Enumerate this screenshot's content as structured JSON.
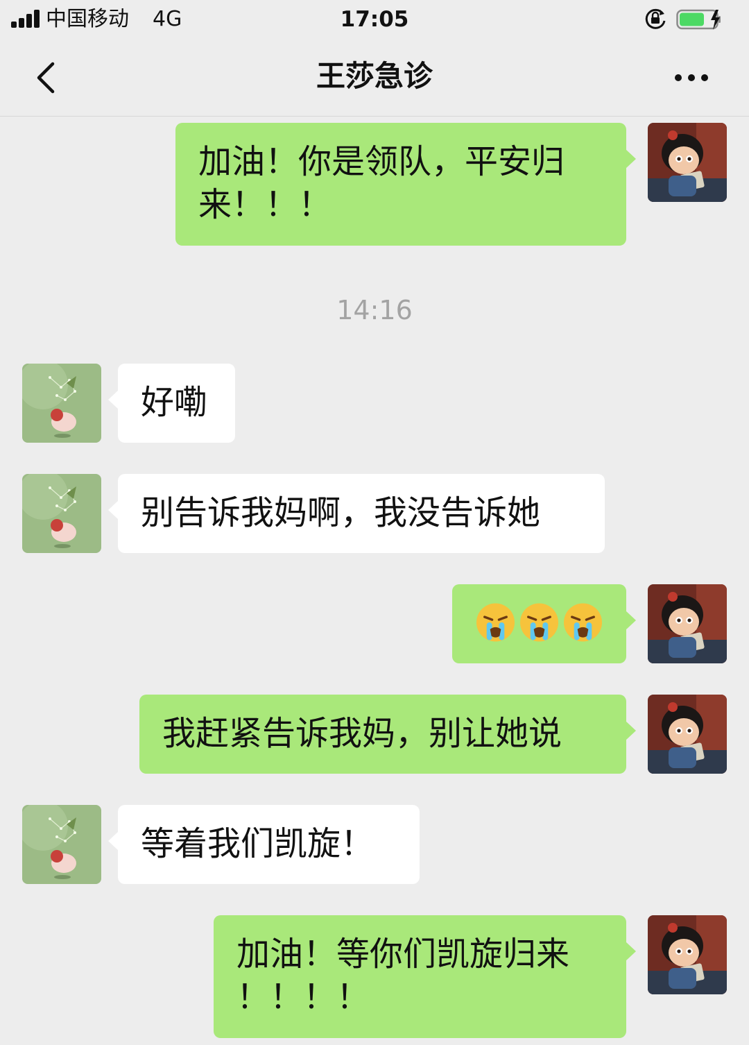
{
  "status_bar": {
    "carrier": "中国移动",
    "network": "4G",
    "time": "17:05",
    "signal_bars": 4,
    "battery_icon": "battery-charging-icon",
    "lock_icon": "orientation-lock-icon"
  },
  "header": {
    "title": "王莎急诊",
    "back_icon": "chevron-left-icon",
    "more_icon": "more-dots-icon"
  },
  "timestamp": "14:16",
  "messages": [
    {
      "sender": "me",
      "text": "加油！你是领队，平安归来！！！",
      "line1": "加油！你是领队，平安归",
      "line2": "来！！！"
    },
    {
      "sender": "them",
      "text": "好嘞"
    },
    {
      "sender": "them",
      "text": "别告诉我妈啊，我没告诉她"
    },
    {
      "sender": "me",
      "emoji": [
        "crying-face",
        "crying-face",
        "crying-face"
      ]
    },
    {
      "sender": "me",
      "text": "我赶紧告诉我妈，别让她说"
    },
    {
      "sender": "them",
      "text": "等着我们凯旋！"
    },
    {
      "sender": "me",
      "text": "加油！等你们凯旋归来！！！！",
      "line1": "加油！等你们凯旋归来",
      "line2": "！！！！"
    }
  ],
  "colors": {
    "background": "#ededed",
    "my_bubble": "#a9e87a",
    "their_bubble": "#ffffff",
    "timestamp_text": "#a3a3a3"
  }
}
